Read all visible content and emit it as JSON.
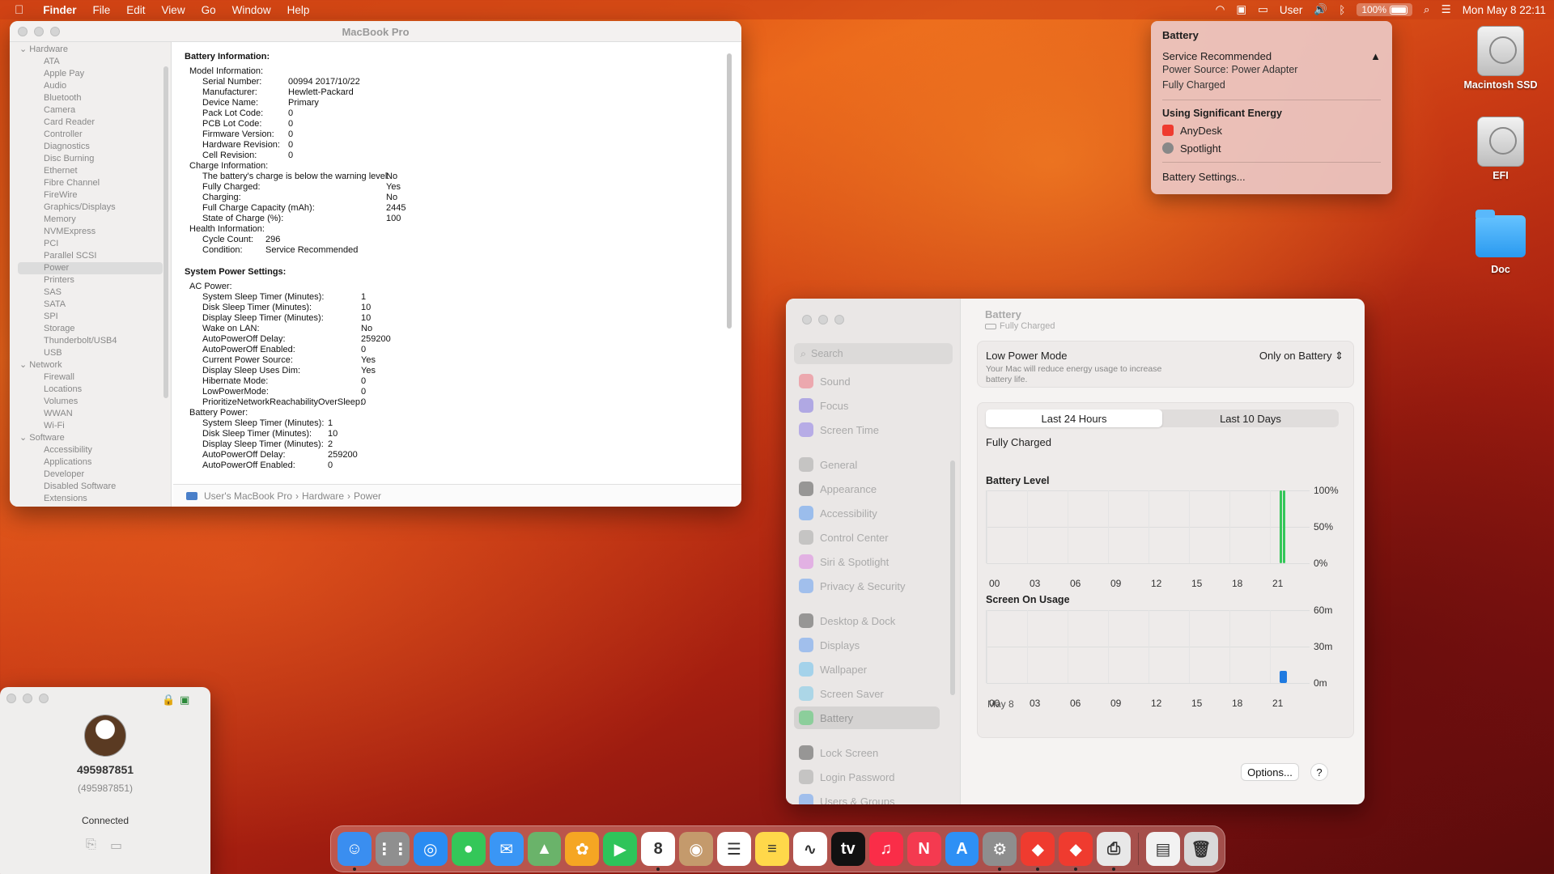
{
  "menubar": {
    "app": "Finder",
    "menus": [
      "File",
      "Edit",
      "View",
      "Go",
      "Window",
      "Help"
    ],
    "user": "User",
    "battery_percent": "100%",
    "datetime": "Mon May 8  22:11"
  },
  "battery_menu": {
    "title": "Battery",
    "service": "Service Recommended",
    "power_source": "Power Source: Power Adapter",
    "status": "Fully Charged",
    "energy_header": "Using Significant Energy",
    "apps": [
      "AnyDesk",
      "Spotlight"
    ],
    "settings_link": "Battery Settings..."
  },
  "desktop": {
    "icons": [
      "Macintosh SSD",
      "EFI",
      "Doc"
    ]
  },
  "sysinfo": {
    "title": "MacBook Pro",
    "tree": [
      {
        "group": "Hardware",
        "items": [
          "ATA",
          "Apple Pay",
          "Audio",
          "Bluetooth",
          "Camera",
          "Card Reader",
          "Controller",
          "Diagnostics",
          "Disc Burning",
          "Ethernet",
          "Fibre Channel",
          "FireWire",
          "Graphics/Displays",
          "Memory",
          "NVMExpress",
          "PCI",
          "Parallel SCSI",
          "Power",
          "Printers",
          "SAS",
          "SATA",
          "SPI",
          "Storage",
          "Thunderbolt/USB4",
          "USB"
        ]
      },
      {
        "group": "Network",
        "items": [
          "Firewall",
          "Locations",
          "Volumes",
          "WWAN",
          "Wi-Fi"
        ]
      },
      {
        "group": "Software",
        "items": [
          "Accessibility",
          "Applications",
          "Developer",
          "Disabled Software",
          "Extensions"
        ]
      }
    ],
    "selected": "Power",
    "battery_info_header": "Battery Information:",
    "model_info_header": "Model Information:",
    "model_info": [
      [
        "Serial Number:",
        "00994 2017/10/22"
      ],
      [
        "Manufacturer:",
        "Hewlett-Packard"
      ],
      [
        "Device Name:",
        "Primary"
      ],
      [
        "Pack Lot Code:",
        "0"
      ],
      [
        "PCB Lot Code:",
        "0"
      ],
      [
        "Firmware Version:",
        "0"
      ],
      [
        "Hardware Revision:",
        "0"
      ],
      [
        "Cell Revision:",
        "0"
      ]
    ],
    "charge_info_header": "Charge Information:",
    "charge_info": [
      [
        "The battery's charge is below the warning level:",
        "No"
      ],
      [
        "Fully Charged:",
        "Yes"
      ],
      [
        "Charging:",
        "No"
      ],
      [
        "Full Charge Capacity (mAh):",
        "2445"
      ],
      [
        "State of Charge (%):",
        "100"
      ]
    ],
    "health_info_header": "Health Information:",
    "health_info": [
      [
        "Cycle Count:",
        "296"
      ],
      [
        "Condition:",
        "Service Recommended"
      ]
    ],
    "power_settings_header": "System Power Settings:",
    "ac_header": "AC Power:",
    "ac_power": [
      [
        "System Sleep Timer (Minutes):",
        "1"
      ],
      [
        "Disk Sleep Timer (Minutes):",
        "10"
      ],
      [
        "Display Sleep Timer (Minutes):",
        "10"
      ],
      [
        "Wake on LAN:",
        "No"
      ],
      [
        "AutoPowerOff Delay:",
        "259200"
      ],
      [
        "AutoPowerOff Enabled:",
        "0"
      ],
      [
        "Current Power Source:",
        "Yes"
      ],
      [
        "Display Sleep Uses Dim:",
        "Yes"
      ],
      [
        "Hibernate Mode:",
        "0"
      ],
      [
        "LowPowerMode:",
        "0"
      ],
      [
        "PrioritizeNetworkReachabilityOverSleep:",
        "0"
      ]
    ],
    "battery_header": "Battery Power:",
    "battery_power": [
      [
        "System Sleep Timer (Minutes):",
        "1"
      ],
      [
        "Disk Sleep Timer (Minutes):",
        "10"
      ],
      [
        "Display Sleep Timer (Minutes):",
        "2"
      ],
      [
        "AutoPowerOff Delay:",
        "259200"
      ],
      [
        "AutoPowerOff Enabled:",
        "0"
      ]
    ],
    "path": [
      "User's MacBook Pro",
      "Hardware",
      "Power"
    ]
  },
  "anydesk": {
    "id": "495987851",
    "id_sub": "(495987851)",
    "status": "Connected"
  },
  "settings": {
    "title": "Battery",
    "subtitle": "Fully Charged",
    "search_placeholder": "Search",
    "nav": [
      {
        "label": "Sound",
        "color": "#f05a6b"
      },
      {
        "label": "Focus",
        "color": "#6a5be0"
      },
      {
        "label": "Screen Time",
        "color": "#7b63e6"
      },
      {
        "label": "General",
        "color": "#9a9a9a"
      },
      {
        "label": "Appearance",
        "color": "#333333"
      },
      {
        "label": "Accessibility",
        "color": "#3b8af5"
      },
      {
        "label": "Control Center",
        "color": "#9a9a9a"
      },
      {
        "label": "Siri & Spotlight",
        "color": "#d96ee0"
      },
      {
        "label": "Privacy & Security",
        "color": "#4a8ef3"
      },
      {
        "label": "Desktop & Dock",
        "color": "#333333"
      },
      {
        "label": "Displays",
        "color": "#4a8ef3"
      },
      {
        "label": "Wallpaper",
        "color": "#4fb8f0"
      },
      {
        "label": "Screen Saver",
        "color": "#62c0e8"
      },
      {
        "label": "Battery",
        "color": "#34c759"
      },
      {
        "label": "Lock Screen",
        "color": "#333333"
      },
      {
        "label": "Login Password",
        "color": "#9a9a9a"
      },
      {
        "label": "Users & Groups",
        "color": "#4a8ef3"
      }
    ],
    "selected": "Battery",
    "low_power_label": "Low Power Mode",
    "low_power_desc": "Your Mac will reduce energy usage to increase battery life.",
    "low_power_value": "Only on Battery",
    "tabs": [
      "Last 24 Hours",
      "Last 10 Days"
    ],
    "active_tab": "Last 24 Hours",
    "status": "Fully Charged",
    "battery_level_title": "Battery Level",
    "screen_usage_title": "Screen On Usage",
    "date_label": "May 8",
    "options_button": "Options...",
    "help_button": "?"
  },
  "chart_data": [
    {
      "type": "bar",
      "title": "Battery Level",
      "x": [
        "00",
        "03",
        "06",
        "09",
        "12",
        "15",
        "18",
        "21"
      ],
      "y_ticks": [
        "100%",
        "50%",
        "0%"
      ],
      "ylim": [
        0,
        100
      ],
      "series": [
        {
          "hour": "21",
          "values": [
            100,
            100
          ]
        }
      ],
      "color": "#34c759"
    },
    {
      "type": "bar",
      "title": "Screen On Usage",
      "x": [
        "00",
        "03",
        "06",
        "09",
        "12",
        "15",
        "18",
        "21"
      ],
      "y_ticks": [
        "60m",
        "30m",
        "0m"
      ],
      "ylim": [
        0,
        60
      ],
      "series": [
        {
          "hour": "21",
          "values": [
            10
          ]
        }
      ],
      "color": "#1f7ae0"
    }
  ],
  "dock": {
    "apps": [
      {
        "name": "Finder",
        "color": "#3a8ef0",
        "glyph": "☺"
      },
      {
        "name": "Launchpad",
        "color": "#8f8f8f",
        "glyph": "⋮⋮"
      },
      {
        "name": "Safari",
        "color": "#2a8cf2",
        "glyph": "◎"
      },
      {
        "name": "Messages",
        "color": "#34c759",
        "glyph": "●"
      },
      {
        "name": "Mail",
        "color": "#3a96f5",
        "glyph": "✉"
      },
      {
        "name": "Maps",
        "color": "#6ab36a",
        "glyph": "▲"
      },
      {
        "name": "Photos",
        "color": "#f5a623",
        "glyph": "✿"
      },
      {
        "name": "FaceTime",
        "color": "#2ec45a",
        "glyph": "▶"
      },
      {
        "name": "Calendar",
        "color": "#ffffff",
        "glyph": "8"
      },
      {
        "name": "Contacts",
        "color": "#c49a6c",
        "glyph": "◉"
      },
      {
        "name": "Reminders",
        "color": "#ffffff",
        "glyph": "☰"
      },
      {
        "name": "Notes",
        "color": "#ffd84a",
        "glyph": "≡"
      },
      {
        "name": "Freeform",
        "color": "#ffffff",
        "glyph": "∿"
      },
      {
        "name": "Apple TV",
        "color": "#111111",
        "glyph": "tv"
      },
      {
        "name": "Music",
        "color": "#fa2d48",
        "glyph": "♫"
      },
      {
        "name": "News",
        "color": "#f43a50",
        "glyph": "N"
      },
      {
        "name": "App Store",
        "color": "#2e90f5",
        "glyph": "A"
      },
      {
        "name": "System Settings",
        "color": "#8e8e8e",
        "glyph": "⚙"
      },
      {
        "name": "AnyDesk",
        "color": "#ef3b2f",
        "glyph": "◆"
      },
      {
        "name": "AnyDesk 2",
        "color": "#ef3b2f",
        "glyph": "◆"
      },
      {
        "name": "Printer",
        "color": "#e8e8e8",
        "glyph": "⎙"
      },
      {
        "name": "Document",
        "color": "#f2f2f2",
        "glyph": "▤"
      },
      {
        "name": "Trash",
        "color": "#d9d9d9",
        "glyph": "🗑"
      }
    ]
  }
}
